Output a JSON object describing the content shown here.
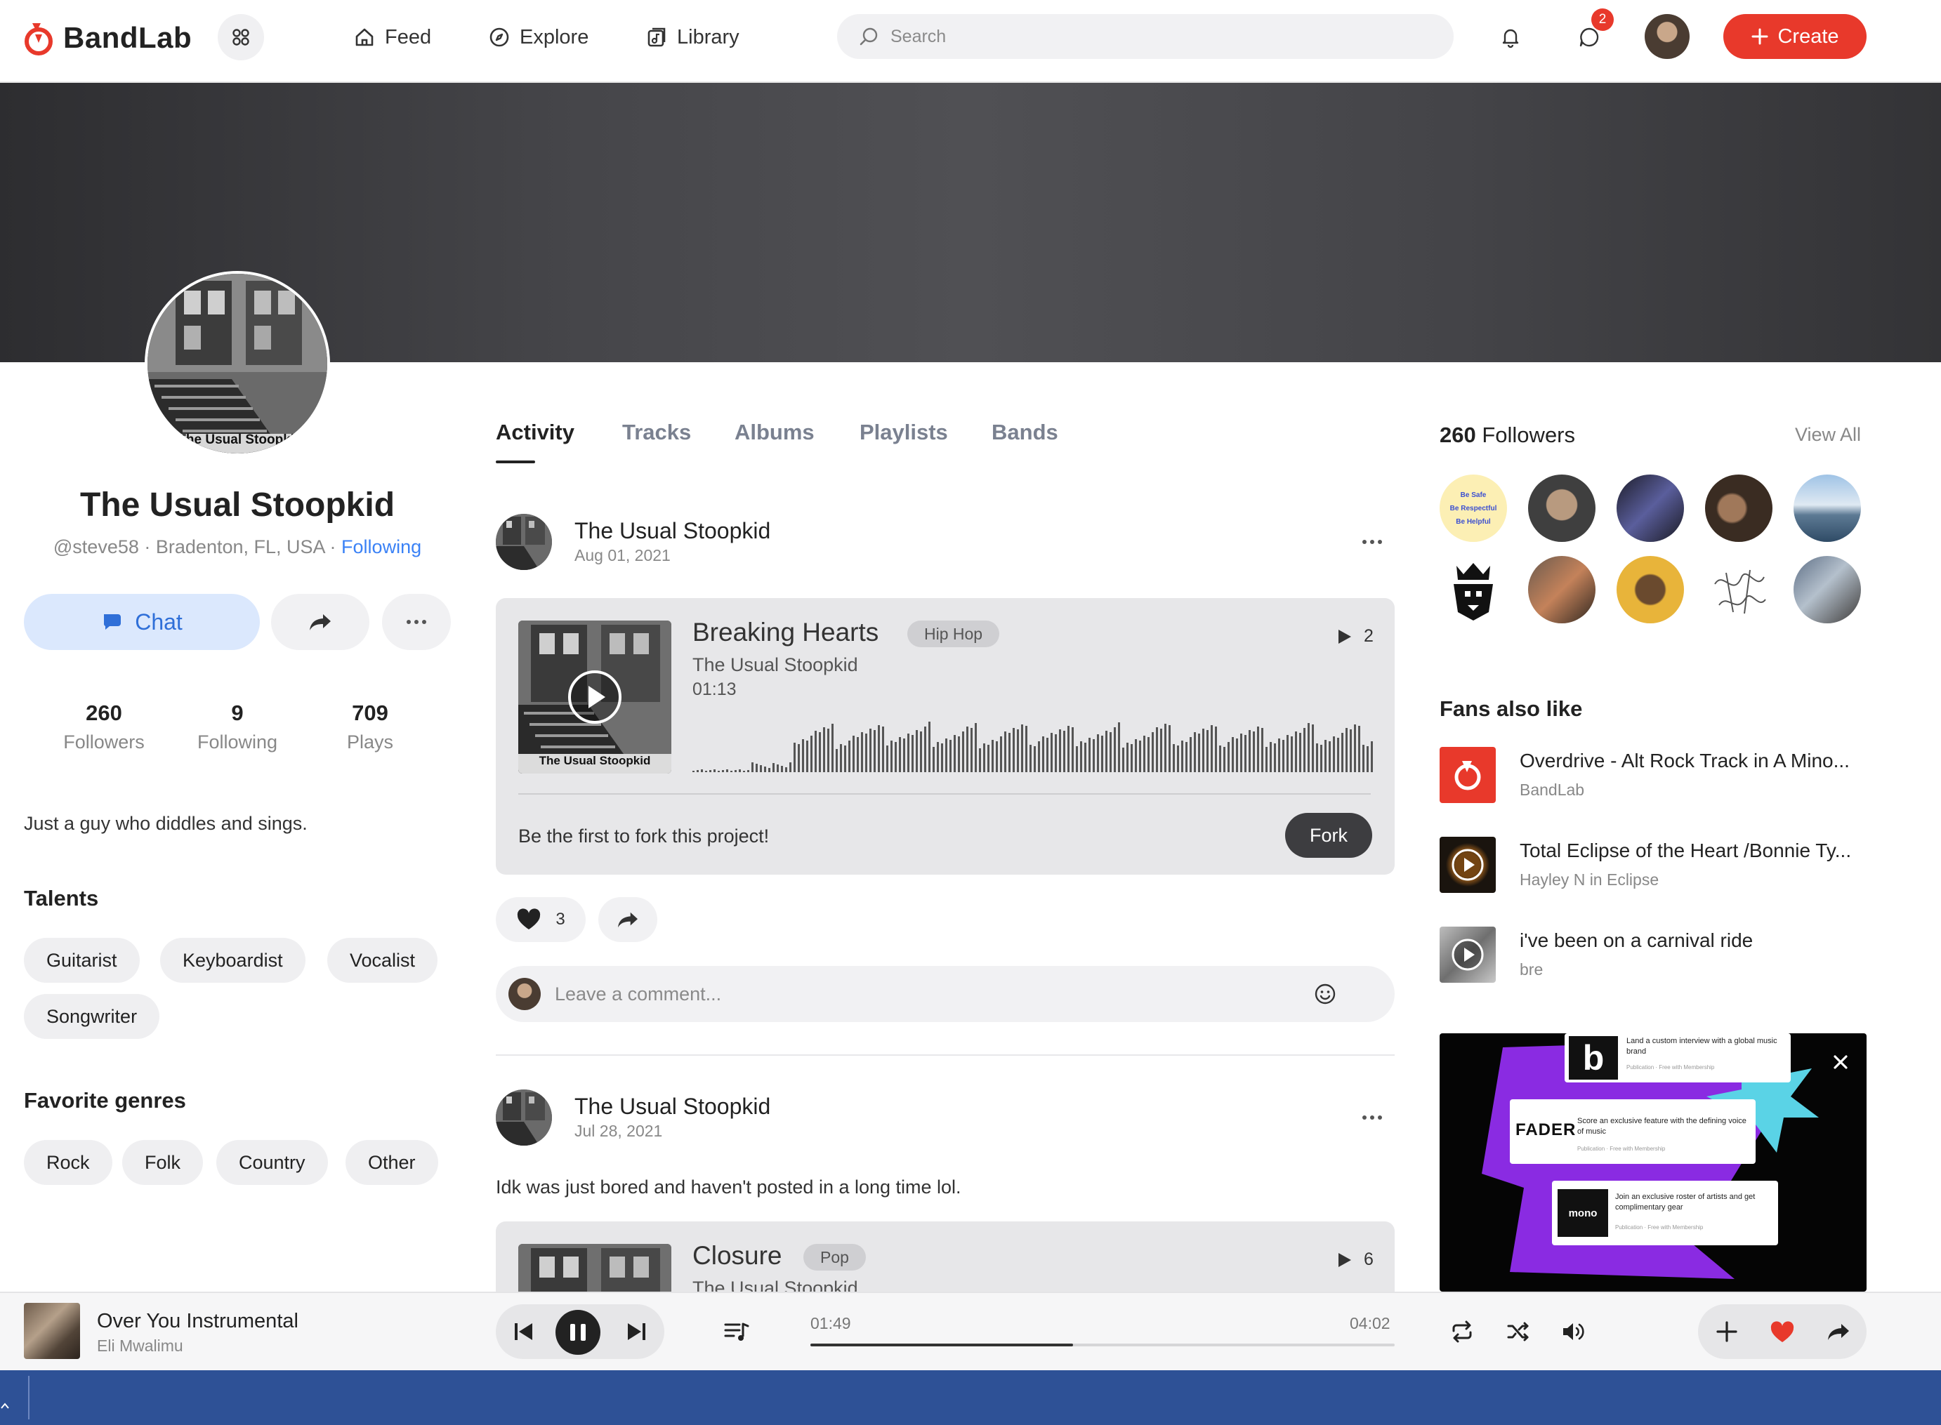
{
  "nav": {
    "brand": "BandLab",
    "feed": "Feed",
    "explore": "Explore",
    "library": "Library",
    "search_placeholder": "Search",
    "messages_badge": "2",
    "create": "Create"
  },
  "profile": {
    "name": "The Usual Stoopkid",
    "handle": "@steve58",
    "location": "Bradenton, FL, USA",
    "follow_status": "Following",
    "chat": "Chat",
    "stats": [
      {
        "value": "260",
        "label": "Followers"
      },
      {
        "value": "9",
        "label": "Following"
      },
      {
        "value": "709",
        "label": "Plays"
      }
    ],
    "bio": "Just a guy who diddles and sings.",
    "talents_title": "Talents",
    "talents": [
      "Guitarist",
      "Keyboardist",
      "Vocalist",
      "Songwriter"
    ],
    "genres_title": "Favorite genres",
    "genres": [
      "Rock",
      "Folk",
      "Country",
      "Other"
    ],
    "art_caption": "The Usual Stoopkid"
  },
  "tabs": [
    "Activity",
    "Tracks",
    "Albums",
    "Playlists",
    "Bands"
  ],
  "posts": [
    {
      "author": "The Usual Stoopkid",
      "date": "Aug 01, 2021",
      "track": {
        "title": "Breaking Hearts",
        "genre": "Hip Hop",
        "artist": "The Usual Stoopkid",
        "duration": "01:13",
        "plays": "2",
        "art_caption": "The Usual Stoopkid"
      },
      "fork_text": "Be the first to fork this project!",
      "fork_button": "Fork",
      "likes": "3",
      "comment_placeholder": "Leave a comment..."
    },
    {
      "author": "The Usual Stoopkid",
      "date": "Jul 28, 2021",
      "text": "Idk was just bored and haven't posted in a long time lol.",
      "track": {
        "title": "Closure",
        "genre": "Pop",
        "artist": "The Usual Stoopkid",
        "plays": "6"
      }
    }
  ],
  "sidebar": {
    "followers_count": "260",
    "followers_label": "Followers",
    "view_all": "View All",
    "first_follower_lines": [
      "Be Safe",
      "Be Respectful",
      "Be Helpful"
    ],
    "fans_title": "Fans also like",
    "fans": [
      {
        "title": "Overdrive - Alt Rock Track in A Mino...",
        "subtitle": "BandLab",
        "color": "#e8392b"
      },
      {
        "title": "Total Eclipse of the Heart /Bonnie Ty...",
        "subtitle": "Hayley N in Eclipse",
        "color": "#1a140e"
      },
      {
        "title": "i've been on a carnival ride",
        "subtitle": "bre",
        "color": "#9a9a9a"
      }
    ],
    "ad": {
      "item1": "Land a custom interview with a global music brand",
      "item1_meta": "Publication · Free with Membership",
      "item2_logo": "FADER",
      "item2": "Score an exclusive feature with the defining voice of music",
      "item2_meta": "Publication · Free with Membership",
      "item3_logo": "mono",
      "item3": "Join an exclusive roster of artists and get complimentary gear",
      "item3_meta": "Publication · Free with Membership"
    }
  },
  "player": {
    "title": "Over You Instrumental",
    "artist": "Eli Mwalimu",
    "current_time": "01:49",
    "total_time": "04:02",
    "progress": 0.45
  },
  "colors": {
    "brand": "#e8392b",
    "link": "#3b82f6",
    "chat_bg": "#dbe8fd",
    "taskbar": "#2e5196"
  }
}
